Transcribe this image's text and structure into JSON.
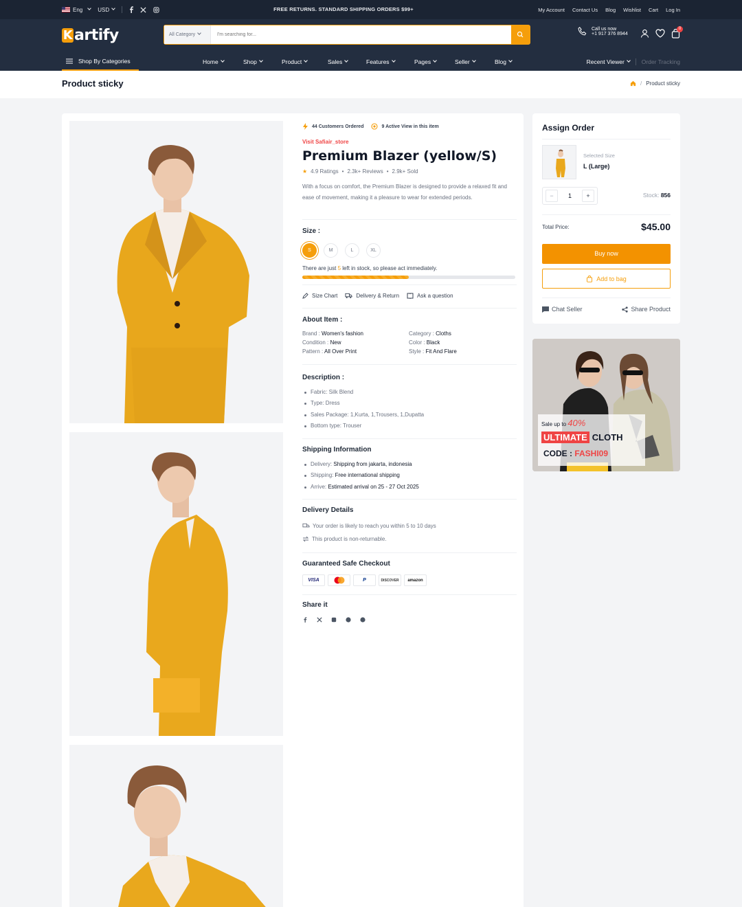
{
  "topbar": {
    "lang": "Eng",
    "currency": "USD",
    "promo": "FREE RETURNS. STANDARD SHIPPING ORDERS $99+",
    "links": [
      "My Account",
      "Contact Us",
      "Blog",
      "Wishlist",
      "Cart",
      "Log In"
    ]
  },
  "header": {
    "logo": "artify",
    "logo_k": "K",
    "search_category": "All Category",
    "search_placeholder": "I'm searching for...",
    "call_label": "Call us now",
    "call_number": "+1 917 376 8944",
    "cart_count": "0"
  },
  "nav": {
    "shop_by": "Shop By Categories",
    "items": [
      "Home",
      "Shop",
      "Product",
      "Sales",
      "Features",
      "Pages",
      "Seller",
      "Blog"
    ],
    "recent": "Recent Viewer",
    "order_tracking": "Order Tracking"
  },
  "page": {
    "title": "Product sticky",
    "breadcrumb_current": "Product sticky"
  },
  "product": {
    "ordered": "44 Customers Ordered",
    "active_view": "9 Active View in this item",
    "store_link": "Visit Safiair_store",
    "name": "Premium Blazer (yellow/S)",
    "ratings": "4.9 Ratings",
    "reviews": "2.3k+ Reviews",
    "sold": "2.9k+ Sold",
    "description": "With a focus on comfort, the Premium Blazer is designed to provide a relaxed fit and ease of movement, making it a pleasure to wear for extended periods.",
    "size_label": "Size :",
    "sizes": [
      "S",
      "M",
      "L",
      "XL"
    ],
    "selected_size": "S",
    "stock_pre": "There are just ",
    "stock_num": "5",
    "stock_post": " left in stock, so please act immediately.",
    "stock_fraction": 0.5,
    "links": {
      "size_chart": "Size Chart",
      "delivery": "Delivery & Return",
      "ask": "Ask a question"
    },
    "about_title": "About Item :",
    "about": [
      {
        "k": "Brand : ",
        "v": "Women's fashion"
      },
      {
        "k": "Category : ",
        "v": "Cloths"
      },
      {
        "k": "Condition : ",
        "v": "New"
      },
      {
        "k": "Color : ",
        "v": "Black"
      },
      {
        "k": "Pattern : ",
        "v": "All Over Print"
      },
      {
        "k": "Style : ",
        "v": "Fit And Flare"
      }
    ],
    "desc_title": "Description :",
    "desc_items": [
      "Fabric: Silk Blend",
      "Type: Dress",
      "Sales Package: 1,Kurta, 1,Trousers, 1,Dupatta",
      "Bottom type: Trouser"
    ],
    "ship_title": "Shipping Information",
    "ship": [
      {
        "k": "Delivery: ",
        "v": "Shipping from jakarta, indonesia"
      },
      {
        "k": "Shipping: ",
        "v": "Free international shipping"
      },
      {
        "k": "Arrive: ",
        "v": "Estimated arrival on 25 - 27 Oct 2025"
      }
    ],
    "delivery_title": "Delivery Details",
    "delivery_lines": [
      "Your order is likely to reach you within 5 to 10 days",
      "This product is non-returnable."
    ],
    "checkout_title": "Guaranteed Safe Checkout",
    "payments": [
      "VISA",
      "mastercard",
      "P",
      "DISCOVER",
      "amazon"
    ],
    "share_title": "Share it"
  },
  "order": {
    "title": "Assign Order",
    "selected_size_label": "Selected Size",
    "selected_size": "L (Large)",
    "qty": "1",
    "minus": "−",
    "plus": "+",
    "stock_label": "Stock: ",
    "stock": "856",
    "total_label": "Total Price:",
    "total": "$45.00",
    "buy": "Buy now",
    "add": "Add to bag",
    "chat": "Chat Seller",
    "share": "Share Product"
  },
  "banner": {
    "sale_pre": "Sale up to ",
    "sale_pct": "40%",
    "ultimate": "ULTIMATE",
    "cloth": "CLOTH",
    "code_label": "CODE : ",
    "code": "FASHI09"
  },
  "colors": {
    "accent": "#f59e0b",
    "dark": "#232e40",
    "red": "#ef4444"
  }
}
